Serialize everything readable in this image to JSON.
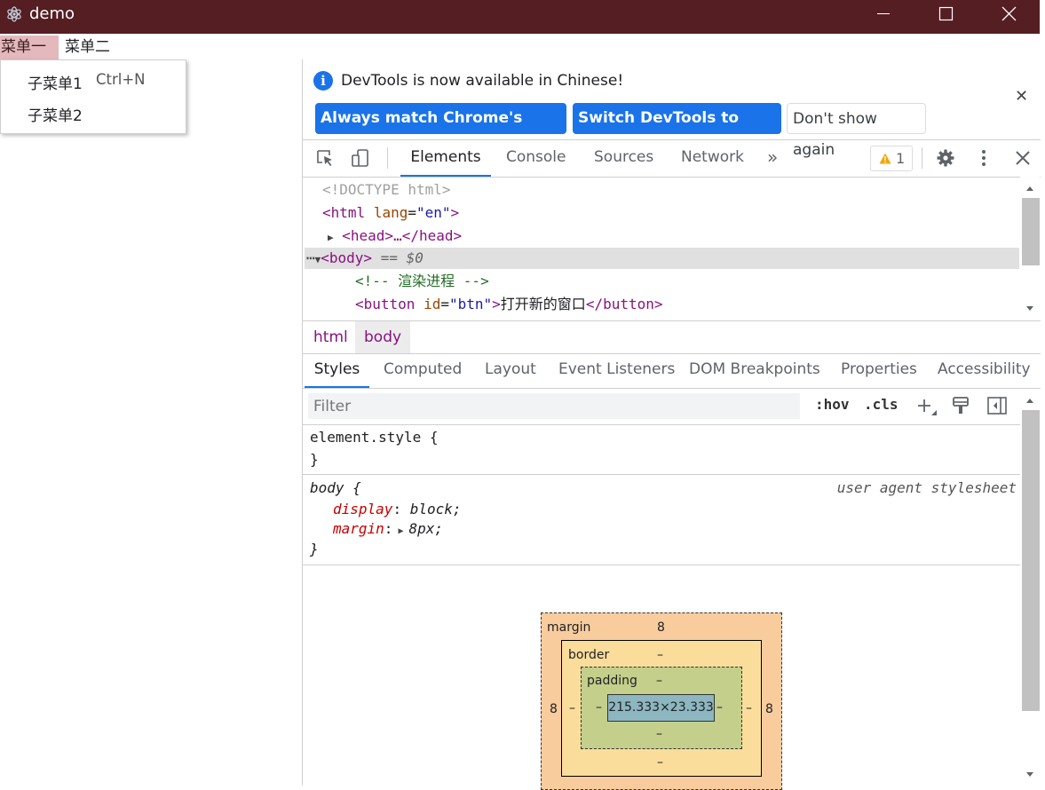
{
  "window": {
    "title": "demo",
    "titlebar_color": "#541e23"
  },
  "menubar": {
    "items": [
      {
        "label": "菜单一"
      },
      {
        "label": "菜单二"
      }
    ]
  },
  "dropdown": {
    "items": [
      {
        "label": "子菜单1",
        "accelerator": "Ctrl+N"
      },
      {
        "label": "子菜单2"
      }
    ]
  },
  "devtools": {
    "infobar": {
      "message": "DevTools is now available in Chinese!",
      "buttons": [
        "Always match Chrome's language",
        "Switch DevTools to Chinese",
        "Don't show again"
      ]
    },
    "tabs": [
      "Elements",
      "Console",
      "Sources",
      "Network"
    ],
    "active_tab": "Elements",
    "warnings_count": "1",
    "dom": {
      "doctype": "<!DOCTYPE html>",
      "html_open_tag": "<html",
      "html_attr": "lang",
      "html_attr_val": "\"en\"",
      "html_close_bracket": ">",
      "head": "<head>…</head>",
      "body_tag": "<body>",
      "body_sel": "== $0",
      "comment": "<!-- 渲染进程 -->",
      "button_open": "<button",
      "button_attr": "id",
      "button_attr_val": "\"btn\"",
      "button_text": "打开新的窗口",
      "button_close": "</button>"
    },
    "breadcrumbs": [
      "html",
      "body"
    ],
    "subtabs": [
      "Styles",
      "Computed",
      "Layout",
      "Event Listeners",
      "DOM Breakpoints",
      "Properties",
      "Accessibility"
    ],
    "filter": {
      "placeholder": "Filter",
      "hov": ":hov",
      "cls": ".cls"
    },
    "rules": {
      "element_style_selector": "element.style {",
      "close_brace": "}",
      "body_selector": "body {",
      "body_source": "user agent stylesheet",
      "display_prop": "display",
      "display_val": "block;",
      "margin_prop": "margin",
      "margin_val": "8px;"
    },
    "boxmodel": {
      "margin_label": "margin",
      "margin_top": "8",
      "margin_left": "8",
      "margin_right": "8",
      "border_label": "border",
      "border_top": "–",
      "border_left": "–",
      "border_right": "–",
      "border_bottom": "–",
      "padding_label": "padding",
      "padding_top": "–",
      "padding_left": "–",
      "padding_right": "–",
      "padding_bottom": "–",
      "content": "215.333×23.333"
    }
  }
}
